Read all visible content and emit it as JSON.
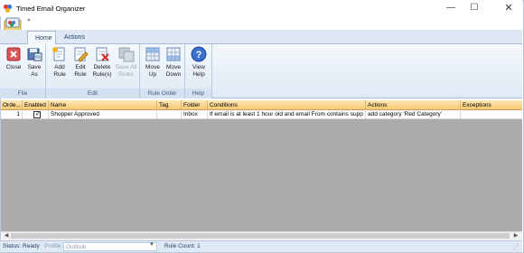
{
  "window": {
    "title": "Timed Email Organizer",
    "controls": {
      "minimize": "—",
      "maximize": "☐",
      "close": "✕"
    }
  },
  "quick_access": {
    "arrow": "⩡"
  },
  "tabs": [
    {
      "label": "Home",
      "active": true
    },
    {
      "label": "Actions",
      "active": false
    }
  ],
  "ribbon": {
    "groups": [
      {
        "label": "File",
        "buttons": [
          {
            "label1": "Close",
            "label2": "",
            "icon": "close-doc-icon",
            "enabled": true
          },
          {
            "label1": "Save",
            "label2": "As",
            "icon": "save-as-icon",
            "enabled": true
          }
        ]
      },
      {
        "label": "Edit",
        "buttons": [
          {
            "label1": "Add",
            "label2": "Rule",
            "icon": "add-rule-icon",
            "enabled": true
          },
          {
            "label1": "Edit",
            "label2": "Rule",
            "icon": "edit-rule-icon",
            "enabled": true
          },
          {
            "label1": "Delete",
            "label2": "Rule(s)",
            "icon": "delete-rule-icon",
            "enabled": true
          },
          {
            "label1": "Save All",
            "label2": "Rules",
            "icon": "save-all-icon",
            "enabled": false
          }
        ]
      },
      {
        "label": "Rule Order",
        "buttons": [
          {
            "label1": "Move",
            "label2": "Up",
            "icon": "move-up-icon",
            "enabled": true
          },
          {
            "label1": "Move",
            "label2": "Down",
            "icon": "move-down-icon",
            "enabled": true
          }
        ]
      },
      {
        "label": "Help",
        "buttons": [
          {
            "label1": "View",
            "label2": "Help",
            "icon": "help-icon",
            "enabled": true
          }
        ]
      }
    ]
  },
  "grid": {
    "columns": [
      "Orde...",
      "Enabled",
      "Name",
      "Tag",
      "Folder",
      "Conditions",
      "Actions",
      "Exceptions"
    ],
    "rows": [
      {
        "order": "1",
        "enabled": true,
        "name": "Shopper Approved",
        "tag": "",
        "folder": "Inbox",
        "conditions": "If email is at least 1 hour old and email From contains supp",
        "actions": "add category 'Red Category'",
        "exceptions": ""
      }
    ]
  },
  "status": {
    "status_text": "Status: Ready",
    "profile_label": "Profile:",
    "profile_value": "Outlook",
    "rule_count": "Rule Count: 1"
  },
  "colors": {
    "ribbon_bg": "#dfe9f5",
    "header_bg": "#f7c872",
    "grid_empty": "#ababab"
  }
}
